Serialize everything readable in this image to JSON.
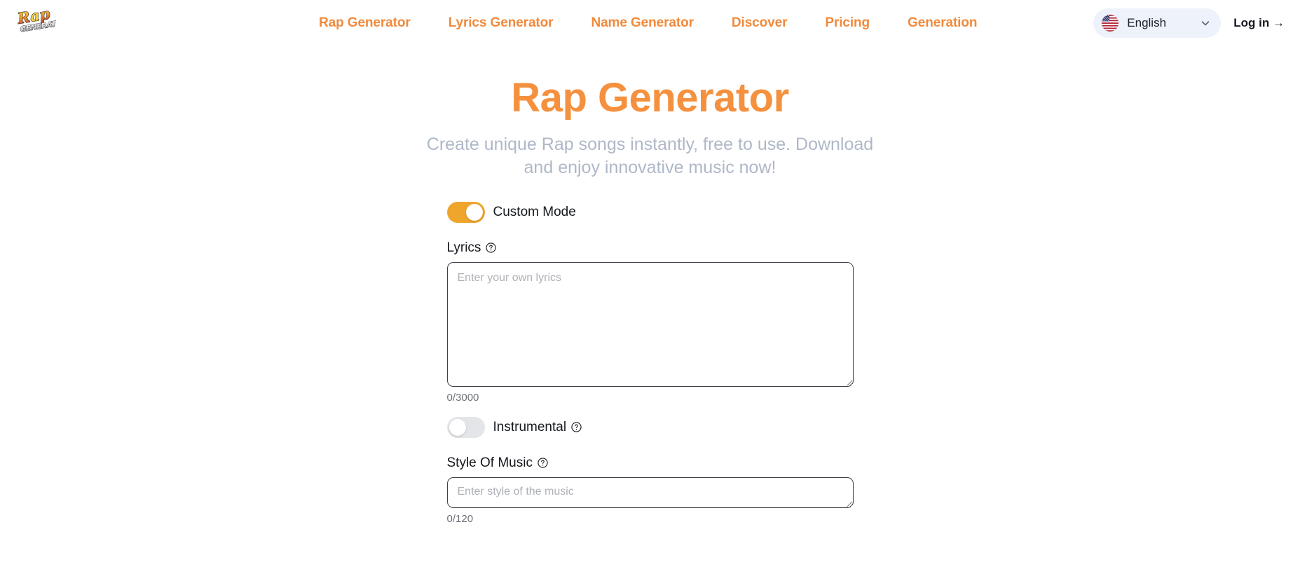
{
  "header": {
    "logo_alt": "Rap Generator",
    "nav": [
      {
        "label": "Rap Generator"
      },
      {
        "label": "Lyrics Generator"
      },
      {
        "label": "Name Generator"
      },
      {
        "label": "Discover"
      },
      {
        "label": "Pricing"
      },
      {
        "label": "Generation"
      }
    ],
    "language": {
      "label": "English",
      "flag": "us-flag-icon",
      "chevron": "chevron-down-icon"
    },
    "login_label": "Log in →"
  },
  "hero": {
    "title": "Rap Generator",
    "subtitle": "Create unique Rap songs instantly, free to use. Download and enjoy innovative music now!"
  },
  "form": {
    "custom_mode": {
      "label": "Custom Mode",
      "state": "on"
    },
    "lyrics": {
      "label": "Lyrics",
      "help": "help-circle-icon",
      "placeholder": "Enter your own lyrics",
      "value": "",
      "counter": "0/3000"
    },
    "instrumental": {
      "label": "Instrumental",
      "help": "help-circle-icon",
      "state": "off"
    },
    "style_of_music": {
      "label": "Style Of Music",
      "help": "help-circle-icon",
      "placeholder": "Enter style of the music",
      "value": "",
      "counter": "0/120"
    }
  },
  "colors": {
    "accent_orange": "#F5913E",
    "toggle_orange": "#EFA42C",
    "nav_orange": "#F18A3C",
    "subtitle_gray": "#AFB8C8",
    "lang_bg": "#EEF2FB"
  }
}
